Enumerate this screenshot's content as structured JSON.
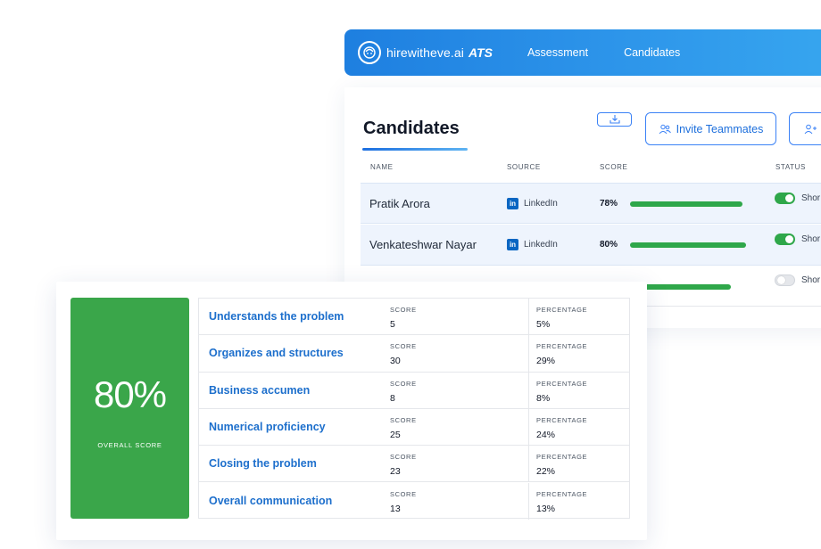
{
  "nav": {
    "brand": "hirewitheve.ai",
    "product": "ATS",
    "links": [
      "Assessment",
      "Candidates"
    ]
  },
  "candidates": {
    "title": "Candidates",
    "invite_label": "Invite Teammates",
    "columns": [
      "NAME",
      "SOURCE",
      "SCORE",
      "STATUS"
    ],
    "rows": [
      {
        "name": "Pratik Arora",
        "source": "LinkedIn",
        "score": "78%",
        "score_fraction": 0.78,
        "status": "Shor",
        "toggle_on": true
      },
      {
        "name": "Venkateshwar Nayar",
        "source": "LinkedIn",
        "score": "80%",
        "score_fraction": 0.8,
        "status": "Shor",
        "toggle_on": true
      },
      {
        "name": "",
        "source": "",
        "score": "",
        "score_fraction": 0.7,
        "status": "Shor",
        "toggle_on": false
      }
    ]
  },
  "assessment": {
    "overall_value": "80%",
    "overall_label": "OVERALL SCORE",
    "score_label": "SCORE",
    "percentage_label": "PERCENTAGE",
    "skills": [
      {
        "name": "Understands the problem",
        "score": "5",
        "percentage": "5%"
      },
      {
        "name": "Organizes and structures",
        "score": "30",
        "percentage": "29%"
      },
      {
        "name": "Business accumen",
        "score": "8",
        "percentage": "8%"
      },
      {
        "name": "Numerical proficiency",
        "score": "25",
        "percentage": "24%"
      },
      {
        "name": "Closing the problem",
        "score": "23",
        "percentage": "22%"
      },
      {
        "name": "Overall communication",
        "score": "13",
        "percentage": "13%"
      }
    ]
  },
  "colors": {
    "accent_blue": "#1d6fdc",
    "score_green": "#3aa64a"
  }
}
